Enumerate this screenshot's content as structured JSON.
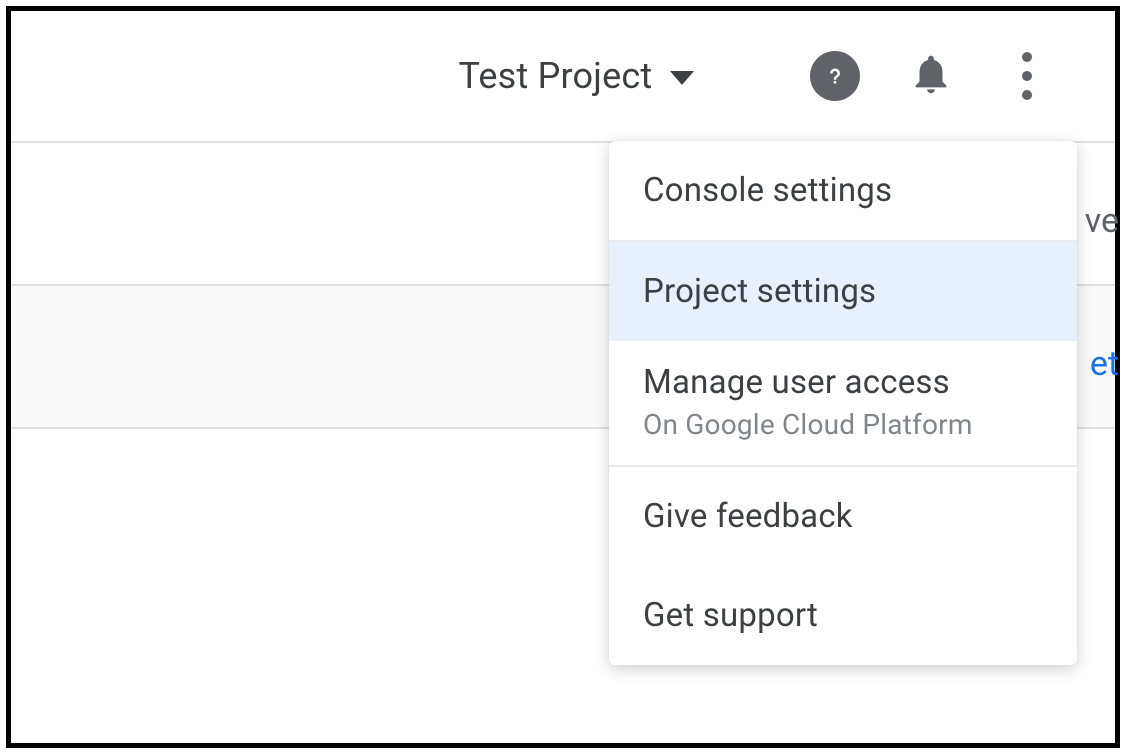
{
  "header": {
    "project_name": "Test Project"
  },
  "menu": {
    "items": [
      {
        "label": "Console settings",
        "highlighted": false,
        "subtitle": null,
        "divider_after": true
      },
      {
        "label": "Project settings",
        "highlighted": true,
        "subtitle": null,
        "divider_after": false
      },
      {
        "label": "Manage user access",
        "highlighted": false,
        "subtitle": "On Google Cloud Platform",
        "divider_after": true
      },
      {
        "label": "Give feedback",
        "highlighted": false,
        "subtitle": null,
        "divider_after": false
      },
      {
        "label": "Get support",
        "highlighted": false,
        "subtitle": null,
        "divider_after": false
      }
    ]
  },
  "background": {
    "partial1": "ve",
    "partial2": "et"
  }
}
